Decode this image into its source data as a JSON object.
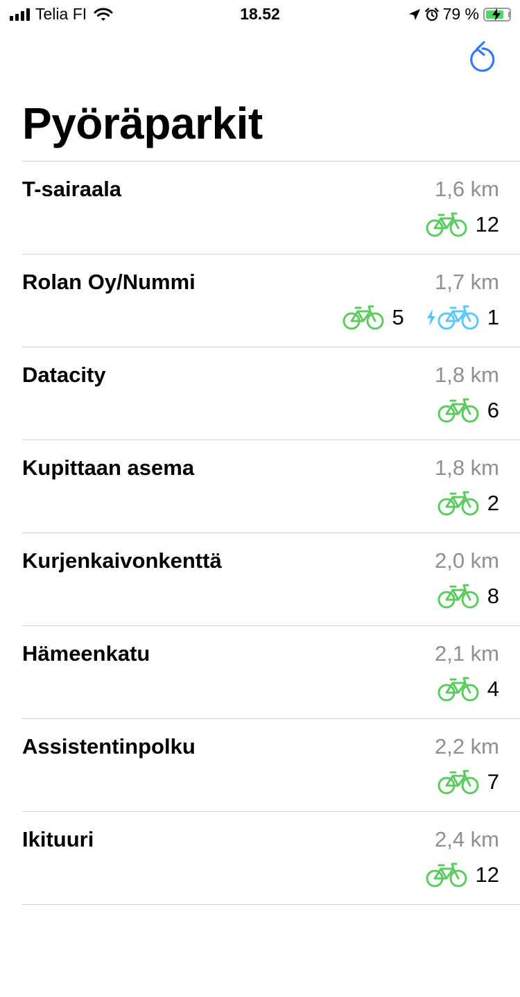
{
  "status_bar": {
    "carrier": "Telia FI",
    "time": "18.52",
    "battery_percent": "79 %",
    "battery_level": 0.79
  },
  "header": {
    "title": "Pyöräparkit",
    "refresh_icon": "refresh-icon"
  },
  "colors": {
    "bike_green": "#5ccb5f",
    "ebike_blue": "#5ac8fa",
    "accent_blue": "#3478f6",
    "secondary_gray": "#8e8e93"
  },
  "stations": [
    {
      "name": "T-sairaala",
      "distance": "1,6 km",
      "bikes": "12"
    },
    {
      "name": "Rolan Oy/Nummi",
      "distance": "1,7 km",
      "bikes": "5",
      "ebikes": "1"
    },
    {
      "name": "Datacity",
      "distance": "1,8 km",
      "bikes": "6"
    },
    {
      "name": "Kupittaan asema",
      "distance": "1,8 km",
      "bikes": "2"
    },
    {
      "name": "Kurjenkaivonkenttä",
      "distance": "2,0 km",
      "bikes": "8"
    },
    {
      "name": "Hämeenkatu",
      "distance": "2,1 km",
      "bikes": "4"
    },
    {
      "name": "Assistentinpolku",
      "distance": "2,2 km",
      "bikes": "7"
    },
    {
      "name": "Ikituuri",
      "distance": "2,4 km",
      "bikes": "12"
    }
  ]
}
